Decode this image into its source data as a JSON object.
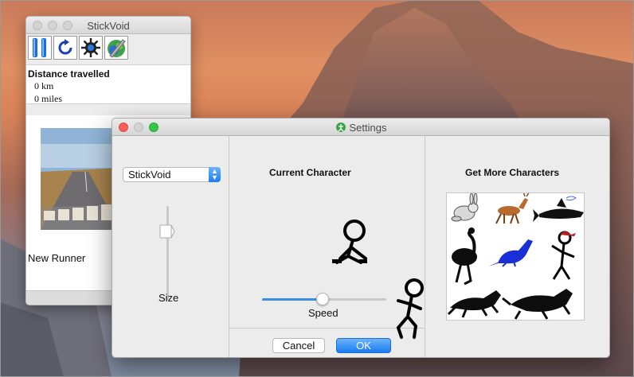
{
  "main_window": {
    "title": "StickVoid",
    "toolbar": [
      "pause-icon",
      "refresh-icon",
      "settings-gear-icon",
      "paint-icon"
    ],
    "distance_title": "Distance travelled",
    "distance_km": "0 km",
    "distance_miles": "0 miles",
    "new_runner_label": "New Runner"
  },
  "settings_window": {
    "title": "Settings",
    "character_select_value": "StickVoid",
    "size_label": "Size",
    "size_value_pct": 0.8,
    "current_character_label": "Current Character",
    "speed_label": "Speed",
    "speed_value_pct": 0.5,
    "cancel_label": "Cancel",
    "ok_label": "OK",
    "get_more_label": "Get More Characters",
    "more_characters": [
      "rabbit",
      "deer",
      "shark",
      "ostrich",
      "kangaroo",
      "ninja-stickman",
      "wolf",
      "wolf"
    ]
  },
  "colors": {
    "accent": "#1a7cf0",
    "close": "#fc5f57",
    "zoom": "#34c84a"
  }
}
